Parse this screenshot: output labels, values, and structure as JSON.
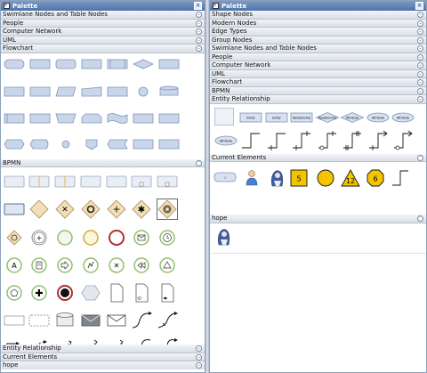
{
  "left": {
    "title": "Palette",
    "sections_top": [
      "Swimlane Nodes and Table Nodes",
      "People",
      "Computer Network",
      "UML",
      "Flowchart"
    ],
    "bpmn_label": "BPMN",
    "sections_bottom": [
      "Entity Relationship",
      "Current Elements",
      "hope"
    ]
  },
  "right": {
    "title": "Palette",
    "sections": [
      "Shape Nodes",
      "Modern Nodes",
      "Edge Types",
      "Group Nodes",
      "Swimlane Nodes and Table Nodes",
      "People",
      "Computer Network",
      "UML",
      "Flowchart",
      "BPMN",
      "Entity Relationship"
    ],
    "er_items": [
      "Entity",
      "Entity",
      "Entity",
      "Relationship",
      "Relationship",
      "Attribute",
      "Attribute",
      "Attribute",
      "Attribute"
    ],
    "current_label": "Current Elements",
    "current_numbers": [
      "5",
      "12",
      "6"
    ],
    "hope_label": "hope"
  },
  "colors": {
    "titlebar": "#4d73a8",
    "header": "#d9dee6",
    "shape_fill": "#c9d6ea",
    "shape_stroke": "#7f95b5",
    "bpmn_event_green": "#8fbf6f",
    "bpmn_event_red": "#b03030",
    "bpmn_gateway": "#f3dfb5",
    "yellow": "#f5c400"
  }
}
